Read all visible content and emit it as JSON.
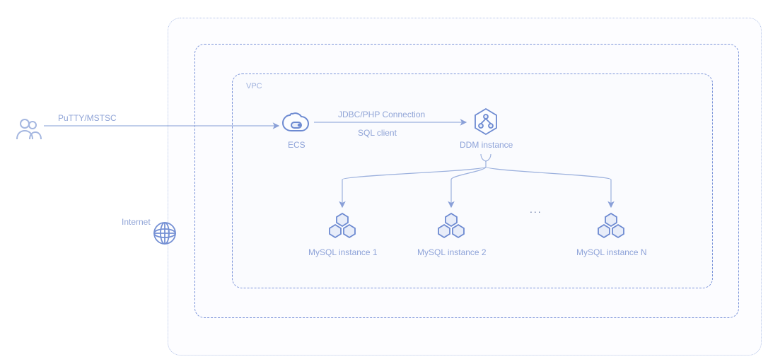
{
  "labels": {
    "vpc": "VPC",
    "internet": "Internet",
    "putty": "PuTTY/MSTSC",
    "jdbc": "JDBC/PHP Connection",
    "sqlclient": "SQL client",
    "ecs": "ECS",
    "ddm": "DDM instance",
    "mysql1": "MySQL instance 1",
    "mysql2": "MySQL instance 2",
    "mysql3": "MySQL instance N",
    "ellipsis": "..."
  },
  "colors": {
    "stroke": "#6d8ad1",
    "lightstroke": "#b4c4e8",
    "fill": "#e8edf9",
    "text": "#8da2d8"
  }
}
